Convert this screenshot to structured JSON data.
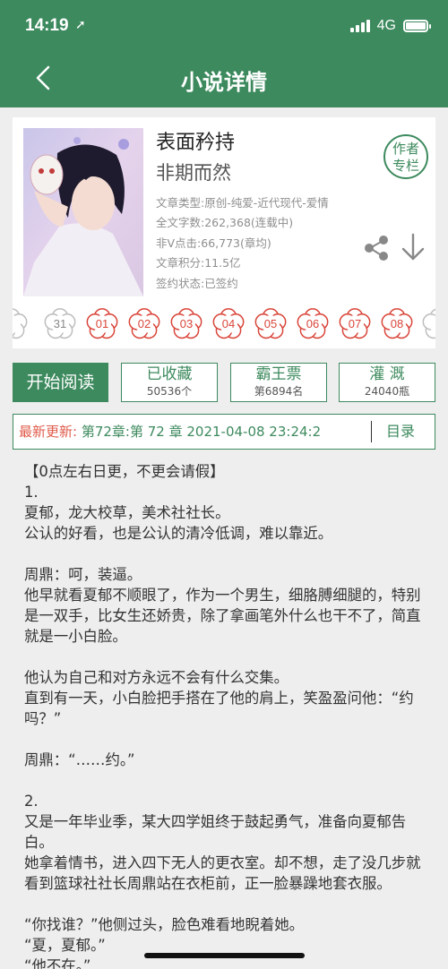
{
  "status_bar": {
    "time": "14:19",
    "network": "4G"
  },
  "nav": {
    "title": "小说详情"
  },
  "book": {
    "title": "表面矜持",
    "author": "非期而然",
    "meta": [
      "文章类型:原创-纯爱-近代现代-爱情",
      "全文字数:262,368(连载中)",
      "非V点击:66,773(章均)",
      "文章积分:11.5亿",
      "签约状态:已签约"
    ],
    "column_label_1": "作者",
    "column_label_2": "专栏"
  },
  "ranks": [
    "31",
    "01",
    "02",
    "03",
    "04",
    "05",
    "06",
    "07",
    "08"
  ],
  "colors": {
    "brand_green": "#3d8a5e",
    "rank_red": "#d9453a",
    "update_red": "#e05b4b"
  },
  "actions": {
    "read": "开始阅读",
    "favorite": {
      "label": "已收藏",
      "count": "50536个"
    },
    "bawangpiao": {
      "label": "霸王票",
      "count": "第6894名"
    },
    "guangai": {
      "label": "灌 溉",
      "count": "24040瓶"
    }
  },
  "update": {
    "label": "最新更新:",
    "value": " 第72章:第 72 章 2021-04-08 23:24:2",
    "toc": "目录"
  },
  "intro": [
    "【0点左右日更，不更会请假】",
    "1.",
    "夏郁，龙大校草，美术社社长。",
    "公认的好看，也是公认的清冷低调，难以靠近。",
    "",
    "周鼎：呵，装逼。",
    "他早就看夏郁不顺眼了，作为一个男生，细胳膊细腿的，特别是一双手，比女生还娇贵，除了拿画笔外什么也干不了，简直就是一小白脸。",
    "",
    "他认为自己和对方永远不会有什么交集。",
    "直到有一天，小白脸把手搭在了他的肩上，笑盈盈问他：“约吗？”",
    "",
    "周鼎：“……约。”",
    "",
    "2.",
    "又是一年毕业季，某大四学姐终于鼓起勇气，准备向夏郁告白。",
    "她拿着情书，进入四下无人的更衣室。却不想，走了没几步就看到篮球社社长周鼎站在衣柜前，正一脸暴躁地套衣服。",
    "",
    "“你找谁？”他侧过头，脸色难看地睨着她。",
    "“夏，夏郁。”",
    "“他不在。”"
  ]
}
